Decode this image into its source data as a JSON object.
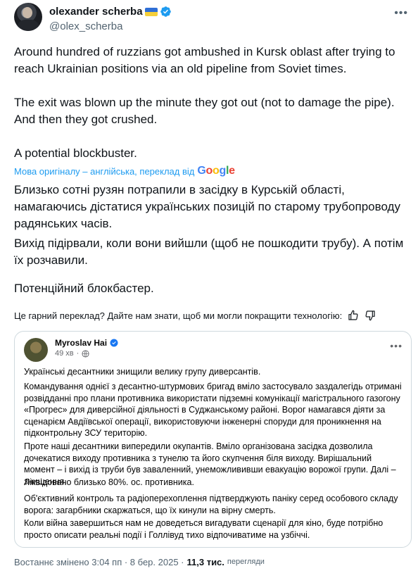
{
  "author": {
    "name": "olexander scherba",
    "handle": "@olex_scherba"
  },
  "tweet": {
    "p1": "Around hundred of ruzzians got ambushed in Kursk oblast after trying to reach Ukrainian positions via an old pipeline from Soviet times.",
    "p2": "The exit was blown up the minute they got out (not to damage the pipe). And then they got crushed.",
    "p3": "A potential blockbuster."
  },
  "translation": {
    "source_label": "Мова оригіналу – англійська, переклад від",
    "provider": "Google",
    "p1": "Близько сотні рузян потрапили в засідку в Курській області, намагаючись дістатися українських позицій по старому трубопроводу радянських часів.",
    "p2": "Вихід підірвали, коли вони вийшли (щоб не пошкодити трубу). А потім їх розчавили.",
    "p3": "Потенційний блокбастер.",
    "feedback": "Це гарний переклад? Дайте нам знати, щоб ми могли покращити технологію:"
  },
  "embedded": {
    "name": "Myroslav Hai",
    "time": "49 хв",
    "p1": "Українські десантники знищили велику групу диверсантів.",
    "p2": "Командування однієї з десантно-штурмових бригад вміло застосувало заздалегідь отримані розвідданні про плани противника використати підземні комунікації магістрального газогону «Прогрес» для диверсійної діяльності в Суджанському районі. Ворог намагався діяти за сценарієм Авдіївської операції, використовуючи інженерні споруди для проникнення на підконтрольну ЗСУ територію.",
    "p3": "Проте наші десантники випередили окупантів. Вміло організована засідка дозволила дочекатися виходу противника з тунелю та його скупчення біля виходу. Вирішальний момент – і вихід із труби був заваленний, унеможлививши евакуацію ворожої групи. Далі – знищення.",
    "p4": "Ліквідовано близько 80%. ос. противника.",
    "p5": "Об'єктивний контроль та радіоперехоплення підтверджують паніку серед особового складу ворога: загарбники скаржаться, що їх кинули на вірну смерть.",
    "p6": "Коли війна завершиться нам не доведеться вигадувати сценарії для кіно, буде потрібно просто описати реальні події і Голлівуд тихо відпочиватиме на узбіччі."
  },
  "meta": {
    "timestamp": "Востаннє змінено 3:04 пп · 8 бер. 2025 ·",
    "views": "11,3 тис.",
    "views_label": "перегляди"
  },
  "colors": {
    "accent": "#1d9bf0",
    "verified": "#1d9bf0",
    "muted": "#536471"
  },
  "icons": [
    "verified-badge-icon",
    "ukraine-flag-icon",
    "more-icon",
    "thumbs-up-icon",
    "thumbs-down-icon",
    "globe-icon"
  ]
}
